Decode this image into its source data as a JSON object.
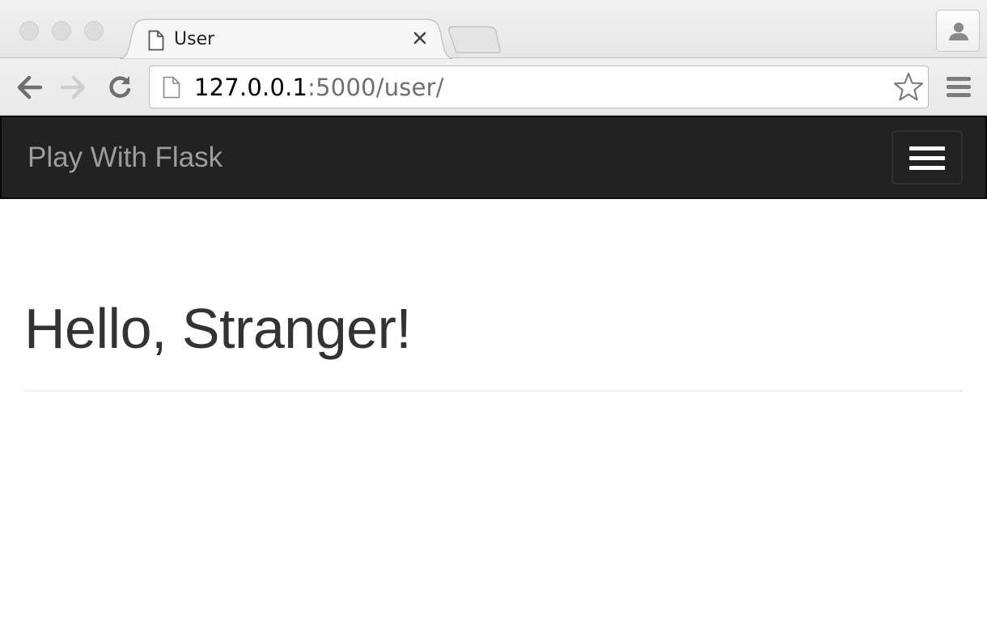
{
  "browser": {
    "tab": {
      "title": "User"
    },
    "address_bar": {
      "host": "127.0.0.1",
      "rest": ":5000/user/"
    }
  },
  "navbar": {
    "brand": "Play With Flask"
  },
  "main": {
    "heading": "Hello, Stranger!"
  },
  "icons": {
    "tab": "page-icon",
    "close": "close-icon",
    "profile": "user-icon",
    "back": "back-arrow-icon",
    "forward": "forward-arrow-icon",
    "reload": "reload-icon",
    "site": "document-icon",
    "bookmark": "star-icon",
    "menu": "hamburger-icon",
    "navbar_toggle": "hamburger-icon"
  },
  "colors": {
    "navbar_bg": "#222222",
    "brand_text": "#9d9d9d",
    "heading_text": "#333333"
  }
}
